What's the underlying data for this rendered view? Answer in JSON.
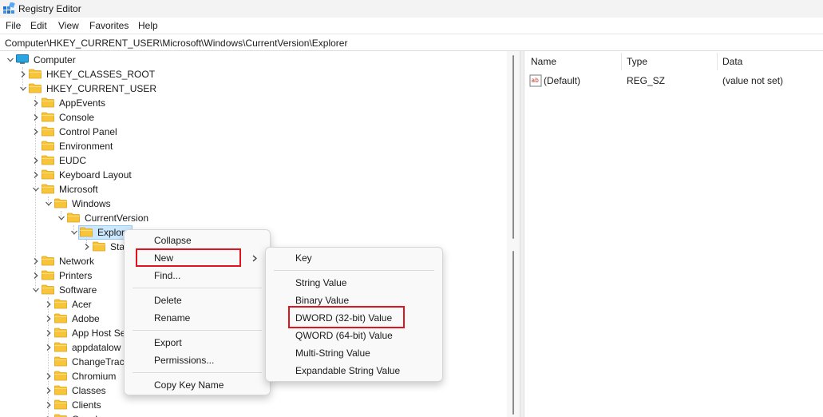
{
  "window": {
    "title": "Registry Editor",
    "icon": "registry-editor-icon"
  },
  "menubar": [
    "File",
    "Edit",
    "View",
    "Favorites",
    "Help"
  ],
  "address": "Computer\\HKEY_CURRENT_USER\\Microsoft\\Windows\\CurrentVersion\\Explorer",
  "tree": [
    {
      "label": "Computer",
      "indent": 0,
      "state": "open",
      "icon": "computer"
    },
    {
      "label": "HKEY_CLASSES_ROOT",
      "indent": 1,
      "state": "closed",
      "icon": "folder"
    },
    {
      "label": "HKEY_CURRENT_USER",
      "indent": 1,
      "state": "open",
      "icon": "folder"
    },
    {
      "label": "AppEvents",
      "indent": 2,
      "state": "closed",
      "icon": "folder"
    },
    {
      "label": "Console",
      "indent": 2,
      "state": "closed",
      "icon": "folder"
    },
    {
      "label": "Control Panel",
      "indent": 2,
      "state": "closed",
      "icon": "folder"
    },
    {
      "label": "Environment",
      "indent": 2,
      "state": "none",
      "icon": "folder"
    },
    {
      "label": "EUDC",
      "indent": 2,
      "state": "closed",
      "icon": "folder"
    },
    {
      "label": "Keyboard Layout",
      "indent": 2,
      "state": "closed",
      "icon": "folder"
    },
    {
      "label": "Microsoft",
      "indent": 2,
      "state": "open",
      "icon": "folder"
    },
    {
      "label": "Windows",
      "indent": 3,
      "state": "open",
      "icon": "folder"
    },
    {
      "label": "CurrentVersion",
      "indent": 4,
      "state": "open",
      "icon": "folder"
    },
    {
      "label": "Explor",
      "indent": 5,
      "state": "open",
      "icon": "folder-open",
      "selected": true
    },
    {
      "label": "Sta",
      "indent": 6,
      "state": "closed",
      "icon": "folder"
    },
    {
      "label": "Network",
      "indent": 2,
      "state": "closed",
      "icon": "folder"
    },
    {
      "label": "Printers",
      "indent": 2,
      "state": "closed",
      "icon": "folder"
    },
    {
      "label": "Software",
      "indent": 2,
      "state": "open",
      "icon": "folder"
    },
    {
      "label": "Acer",
      "indent": 3,
      "state": "closed",
      "icon": "folder"
    },
    {
      "label": "Adobe",
      "indent": 3,
      "state": "closed",
      "icon": "folder"
    },
    {
      "label": "App Host Se",
      "indent": 3,
      "state": "closed",
      "icon": "folder"
    },
    {
      "label": "appdatalow",
      "indent": 3,
      "state": "closed",
      "icon": "folder"
    },
    {
      "label": "ChangeTrack",
      "indent": 3,
      "state": "none",
      "icon": "folder"
    },
    {
      "label": "Chromium",
      "indent": 3,
      "state": "closed",
      "icon": "folder"
    },
    {
      "label": "Classes",
      "indent": 3,
      "state": "closed",
      "icon": "folder"
    },
    {
      "label": "Clients",
      "indent": 3,
      "state": "closed",
      "icon": "folder"
    },
    {
      "label": "Google",
      "indent": 3,
      "state": "closed",
      "icon": "folder"
    }
  ],
  "values": {
    "columns": [
      "Name",
      "Type",
      "Data"
    ],
    "rows": [
      {
        "name": "(Default)",
        "type": "REG_SZ",
        "data": "(value not set)",
        "icon": "string-value-icon"
      }
    ]
  },
  "context_menu": {
    "collapse": "Collapse",
    "new": "New",
    "find": "Find...",
    "delete": "Delete",
    "rename": "Rename",
    "export": "Export",
    "permissions": "Permissions...",
    "copy_key_name": "Copy Key Name"
  },
  "submenu": {
    "key": "Key",
    "string_value": "String Value",
    "binary_value": "Binary Value",
    "dword_value": "DWORD (32-bit) Value",
    "qword_value": "QWORD (64-bit) Value",
    "multi_string_value": "Multi-String Value",
    "expandable_string_value": "Expandable String Value"
  },
  "colors": {
    "highlight": "#e0141e",
    "selection": "#cce8ff",
    "folder": "#f8c43a"
  }
}
